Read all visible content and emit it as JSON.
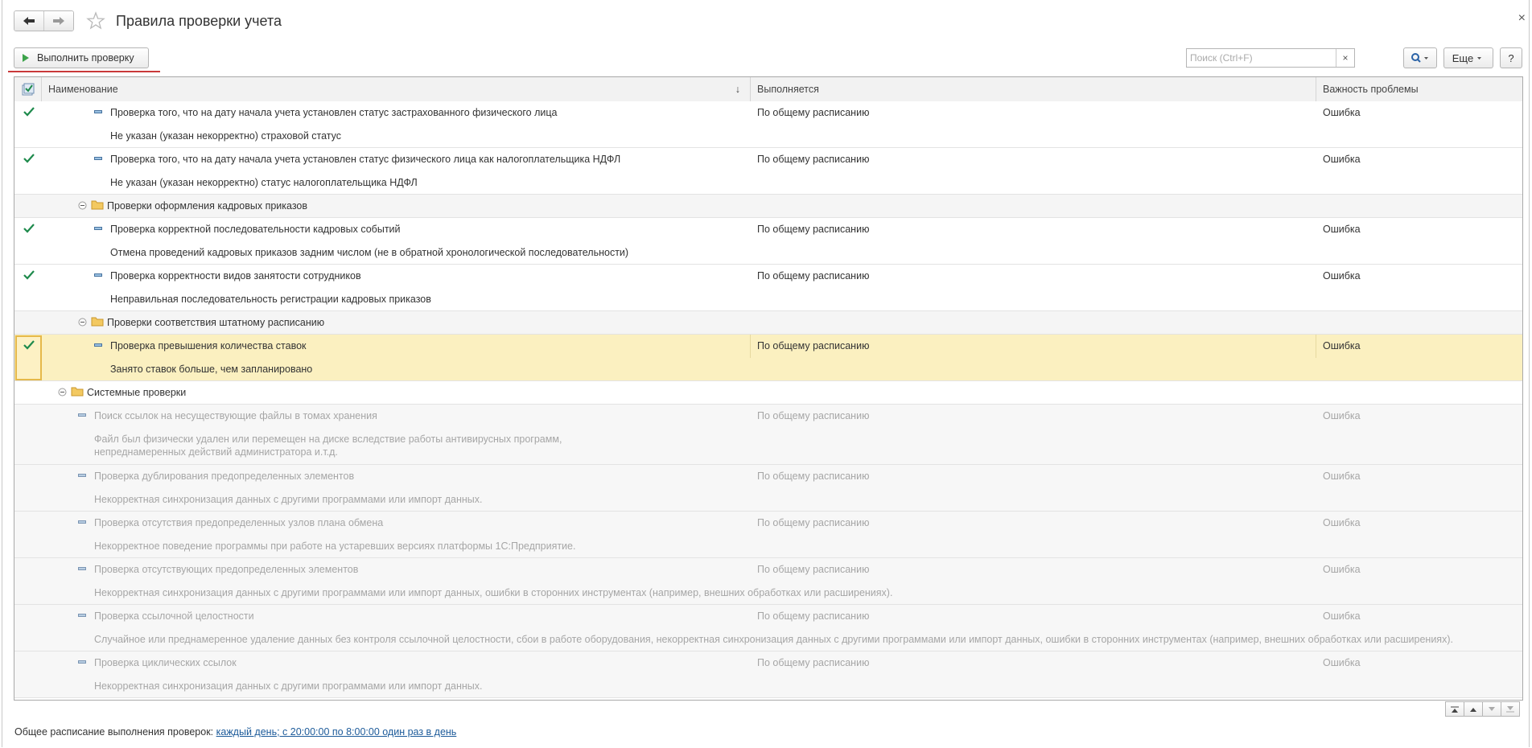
{
  "window": {
    "title": "Правила проверки учета",
    "close_glyph": "×"
  },
  "toolbar": {
    "run_label": "Выполнить проверку",
    "search_placeholder": "Поиск (Ctrl+F)",
    "search_clear": "×",
    "more_label": "Еще",
    "help_label": "?"
  },
  "table": {
    "columns": {
      "name": "Наименование",
      "sort_indicator": "↓",
      "runs": "Выполняется",
      "severity": "Важность проблемы"
    },
    "rows": [
      {
        "kind": "rule",
        "checked": true,
        "level": 3,
        "active": true,
        "name": "Проверка того, что на дату начала учета установлен статус застрахованного физического лица",
        "desc": "Не указан (указан некорректно) страховой статус",
        "runs": "По общему расписанию",
        "severity": "Ошибка"
      },
      {
        "kind": "rule",
        "checked": true,
        "level": 3,
        "active": true,
        "name": "Проверка того, что на дату начала учета установлен статус физического лица как налогоплательщика НДФЛ",
        "desc": "Не указан (указан некорректно) статус налогоплательщика НДФЛ",
        "runs": "По общему расписанию",
        "severity": "Ошибка"
      },
      {
        "kind": "group",
        "level": 2,
        "name": "Проверки оформления кадровых приказов"
      },
      {
        "kind": "rule",
        "checked": true,
        "level": 3,
        "active": true,
        "name": "Проверка корректной последовательности кадровых событий",
        "desc": "Отмена проведений кадровых приказов задним числом (не в обратной хронологической последовательности)",
        "runs": "По общему расписанию",
        "severity": "Ошибка"
      },
      {
        "kind": "rule",
        "checked": true,
        "level": 3,
        "active": true,
        "name": "Проверка корректности видов занятости сотрудников",
        "desc": "Неправильная последовательность регистрации кадровых приказов",
        "runs": "По общему расписанию",
        "severity": "Ошибка"
      },
      {
        "kind": "group",
        "level": 2,
        "name": "Проверки соответствия штатному расписанию"
      },
      {
        "kind": "rule",
        "checked": true,
        "level": 3,
        "active": true,
        "selected": true,
        "name": "Проверка превышения количества ставок",
        "desc": "Занято ставок больше, чем запланировано",
        "runs": "По общему расписанию",
        "severity": "Ошибка"
      },
      {
        "kind": "group",
        "level": 1,
        "name": "Системные проверки"
      },
      {
        "kind": "rule",
        "checked": false,
        "level": 2,
        "active": false,
        "name": "Поиск ссылок на несуществующие файлы в томах хранения",
        "desc": "Файл был физически удален или перемещен на диске вследствие работы антивирусных программ,",
        "desc2": "непреднамеренных действий администратора и.т.д.",
        "runs": "По общему расписанию",
        "severity": "Ошибка"
      },
      {
        "kind": "rule",
        "checked": false,
        "level": 2,
        "active": false,
        "name": "Проверка дублирования предопределенных элементов",
        "desc": "Некорректная синхронизация данных с другими программами или импорт данных.",
        "runs": "По общему расписанию",
        "severity": "Ошибка"
      },
      {
        "kind": "rule",
        "checked": false,
        "level": 2,
        "active": false,
        "name": "Проверка отсутствия предопределенных узлов плана обмена",
        "desc": "Некорректное поведение программы при работе на устаревших версиях платформы 1С:Предприятие.",
        "runs": "По общему расписанию",
        "severity": "Ошибка"
      },
      {
        "kind": "rule",
        "checked": false,
        "level": 2,
        "active": false,
        "name": "Проверка отсутствующих предопределенных элементов",
        "desc": "Некорректная синхронизация данных с другими программами или импорт данных, ошибки в сторонних инструментах (например, внешних обработках или расширениях).",
        "runs": "По общему расписанию",
        "severity": "Ошибка"
      },
      {
        "kind": "rule",
        "checked": false,
        "level": 2,
        "active": false,
        "name": "Проверка ссылочной целостности",
        "desc": "Случайное или преднамеренное удаление данных без контроля ссылочной целостности, сбои в работе оборудования, некорректная синхронизация данных с другими программами или импорт данных, ошибки в сторонних инструментах (например, внешних обработках или расширениях).",
        "runs": "По общему расписанию",
        "severity": "Ошибка"
      },
      {
        "kind": "rule",
        "checked": false,
        "level": 2,
        "active": false,
        "name": "Проверка циклических ссылок",
        "desc": "Некорректная синхронизация данных с другими программами или импорт данных.",
        "runs": "По общему расписанию",
        "severity": "Ошибка"
      }
    ]
  },
  "footer": {
    "label": "Общее расписание выполнения проверок:",
    "link": "каждый день; с 20:00:00 по 8:00:00 один раз в день"
  },
  "colors": {
    "check": "#1e8a4c",
    "selected_row": "#fbf0c0",
    "selected_border": "#e6b94a",
    "run_icon": "#3ca34a",
    "link": "#1d5b9a",
    "accent_underline": "#c9393a"
  }
}
